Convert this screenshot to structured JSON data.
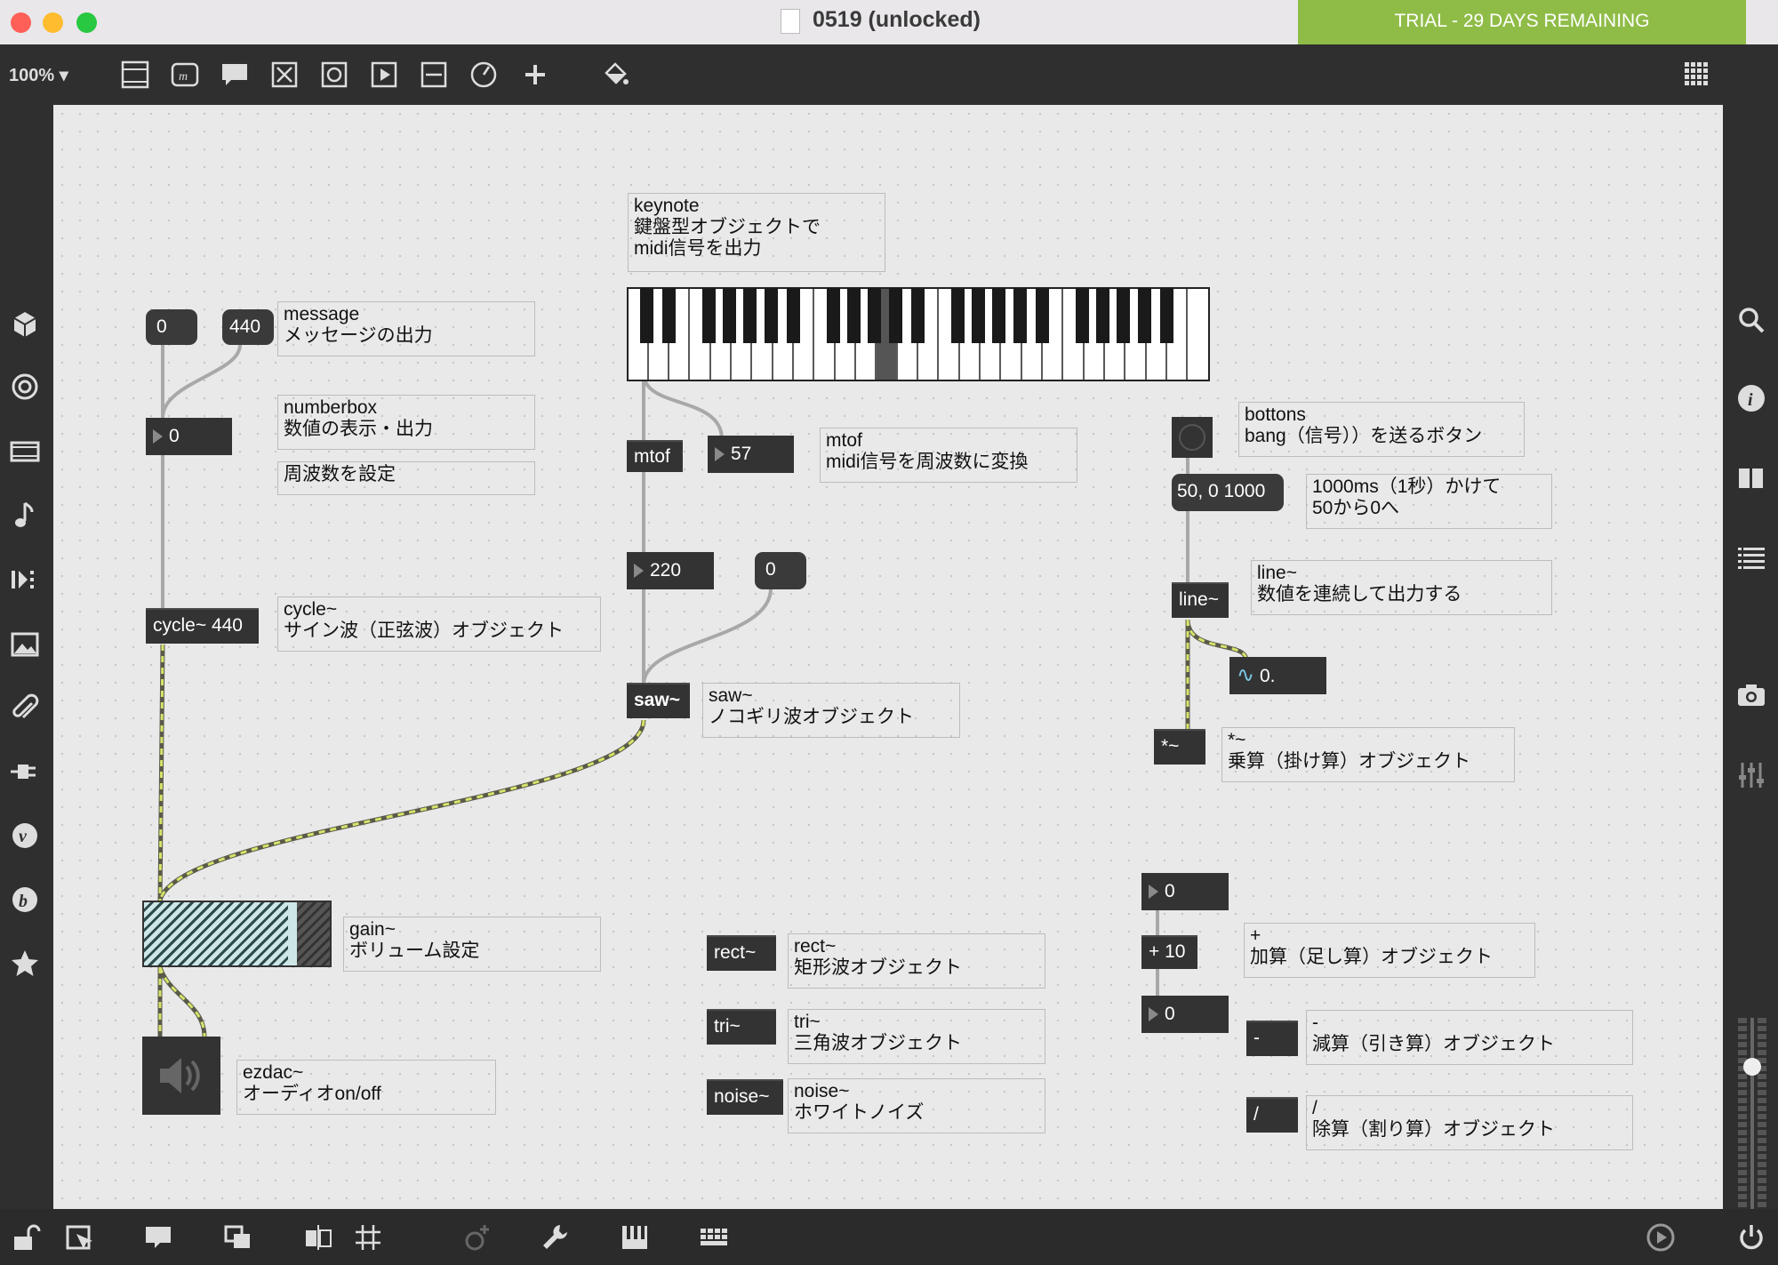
{
  "window": {
    "title": "0519 (unlocked)",
    "trial_banner": "TRIAL - 29 DAYS REMAINING"
  },
  "toolbar": {
    "zoom": "100%",
    "icons": [
      "patcher-icon",
      "message-icon",
      "comment-icon",
      "toggle-icon",
      "button-icon",
      "play-icon",
      "slider-icon",
      "dial-icon",
      "add-icon",
      "paint-bucket-icon"
    ],
    "grid_icon": "grid-icon"
  },
  "left_sidebar": [
    "cube-icon",
    "target-icon",
    "film-icon",
    "note-icon",
    "step-icon",
    "image-icon",
    "paperclip-icon",
    "plug-icon",
    "v-icon",
    "b-icon",
    "star-icon"
  ],
  "right_sidebar": [
    "search-icon",
    "info-icon",
    "columns-icon",
    "list-icon",
    "camera-icon",
    "mixer-icon"
  ],
  "patch": {
    "messages": {
      "zero": "0",
      "f440": "440",
      "ramp": "50, 0 1000",
      "zero2": "0"
    },
    "numbers": {
      "nb1": "0",
      "midi": "57",
      "freq": "220",
      "add_in": "0",
      "add_out": "0",
      "sig": "0."
    },
    "objects": {
      "mtof": "mtof",
      "cycle": "cycle~ 440",
      "saw": "saw~",
      "line": "line~",
      "mul": "*~",
      "rect": "rect~",
      "tri": "tri~",
      "noise": "noise~",
      "plus": "+ 10",
      "minus": "-",
      "div": "/"
    },
    "comments": {
      "keynote": "keynote\n鍵盤型オブジェクトで\nmidi信号を出力",
      "message": "message\nメッセージの出力",
      "numberbox": "numberbox\n数値の表示・出力",
      "freq": "周波数を設定",
      "mtof": "mtof\nmidi信号を周波数に変換",
      "bottons": "bottons\nbang（信号））を送るボタン",
      "ramp": "1000ms（1秒）かけて\n50から0へ",
      "line": "line~\n数値を連続して出力する",
      "cycle": "cycle~\nサイン波（正弦波）オブジェクト",
      "saw": "saw~\nノコギリ波オブジェクト",
      "mul": "*~\n乗算（掛け算）オブジェクト",
      "gain": "gain~\nボリューム設定",
      "ezdac": "ezdac~\nオーディオon/off",
      "rect": "rect~\n矩形波オブジェクト",
      "tri": "tri~\n三角波オブジェクト",
      "noise": "noise~\nホワイトノイズ",
      "plus": "+\n加算（足し算）オブジェクト",
      "minus": "-\n減算（引き算）オブジェクト",
      "div": "/\n除算（割り算）オブジェクト"
    }
  },
  "bottom_toolbar": [
    "lock-icon",
    "presentation-icon",
    "comment-bubble-icon",
    "layers-icon",
    "toggle-visibility-icon",
    "grid-snap-icon",
    "add-object-icon",
    "wrench-icon",
    "piano-icon",
    "keyboard-icon",
    "play-circle-icon",
    "power-icon"
  ]
}
